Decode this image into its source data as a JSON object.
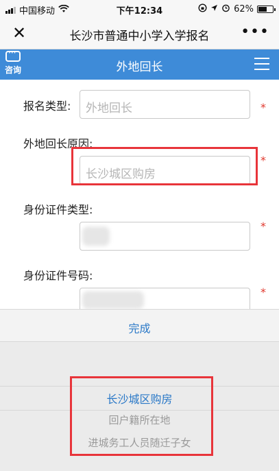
{
  "status_bar": {
    "carrier": "中国移动",
    "time": "下午12:34",
    "battery": "62%",
    "battery_level": 0.62
  },
  "nav": {
    "close_glyph": "✕",
    "title": "长沙市普通中小学入学报名",
    "more_glyph": "•••"
  },
  "header": {
    "consult_label": "咨询",
    "title": "外地回长"
  },
  "form": {
    "fields": [
      {
        "label": "报名类型:",
        "value": "外地回长"
      },
      {
        "label": "外地回长原因:",
        "value": "长沙城区购房"
      },
      {
        "label": "身份证件类型:",
        "value": ""
      },
      {
        "label": "身份证件号码:",
        "value": ""
      }
    ],
    "required_mark": "*"
  },
  "picker": {
    "done_label": "完成",
    "options": [
      "长沙城区购房",
      "回户籍所在地",
      "进城务工人员随迁子女"
    ],
    "selected": "长沙城区购房"
  },
  "colors": {
    "header_blue": "#3e8bd8",
    "accent_blue": "#2a78c7",
    "required_red": "#e13a2f",
    "highlight_red": "#e8343a"
  }
}
